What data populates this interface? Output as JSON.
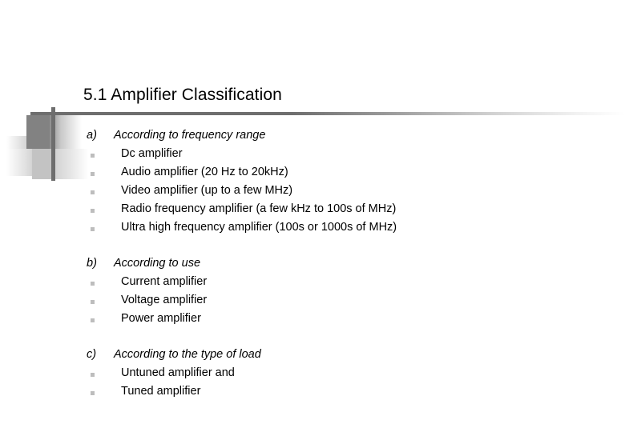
{
  "slide": {
    "title": "5.1 Amplifier Classification",
    "accent_color": "#6e6e6e",
    "bullet_color": "#bdbdbd",
    "text_color": "#000000",
    "background_color": "#ffffff"
  },
  "sections": [
    {
      "label": "a)",
      "title": "According to frequency range",
      "items": [
        "Dc amplifier",
        "Audio amplifier (20 Hz to 20kHz)",
        "Video amplifier (up to a few MHz)",
        "Radio frequency amplifier (a few kHz to 100s of MHz)",
        "Ultra high frequency amplifier (100s or 1000s of MHz)"
      ]
    },
    {
      "label": "b)",
      "title": "According to use",
      "items": [
        "Current amplifier",
        "Voltage amplifier",
        "Power amplifier"
      ]
    },
    {
      "label": "c)",
      "title": "According to the type of load",
      "items": [
        "Untuned amplifier and",
        "Tuned amplifier"
      ]
    }
  ]
}
